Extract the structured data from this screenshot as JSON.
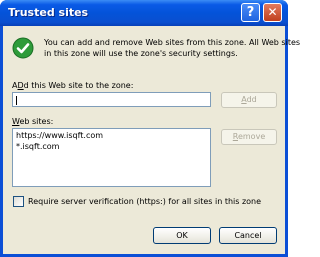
{
  "title": "Trusted sites",
  "title_buttons": {
    "help": "?",
    "close": "✕"
  },
  "info": {
    "line1": "You can add and remove Web sites from this zone. All Web sites",
    "line2": "in this zone will use the zone's security settings."
  },
  "add_label": {
    "hotkey": "D",
    "before": "A",
    "after": "d this Web site to the zone:"
  },
  "add_input_value": "",
  "add_button": {
    "hotkey": "A",
    "rest": "dd"
  },
  "websites_label": {
    "hotkey": "W",
    "rest": "eb sites:"
  },
  "websites": [
    "https://www.isqft.com",
    "*.isqft.com"
  ],
  "remove_button": {
    "hotkey": "R",
    "rest": "emove"
  },
  "require_checkbox": {
    "checked": false,
    "label": "Require server verification (https:) for all sites in this zone",
    "hotkey": "S"
  },
  "ok_label": "OK",
  "cancel_label": "Cancel"
}
